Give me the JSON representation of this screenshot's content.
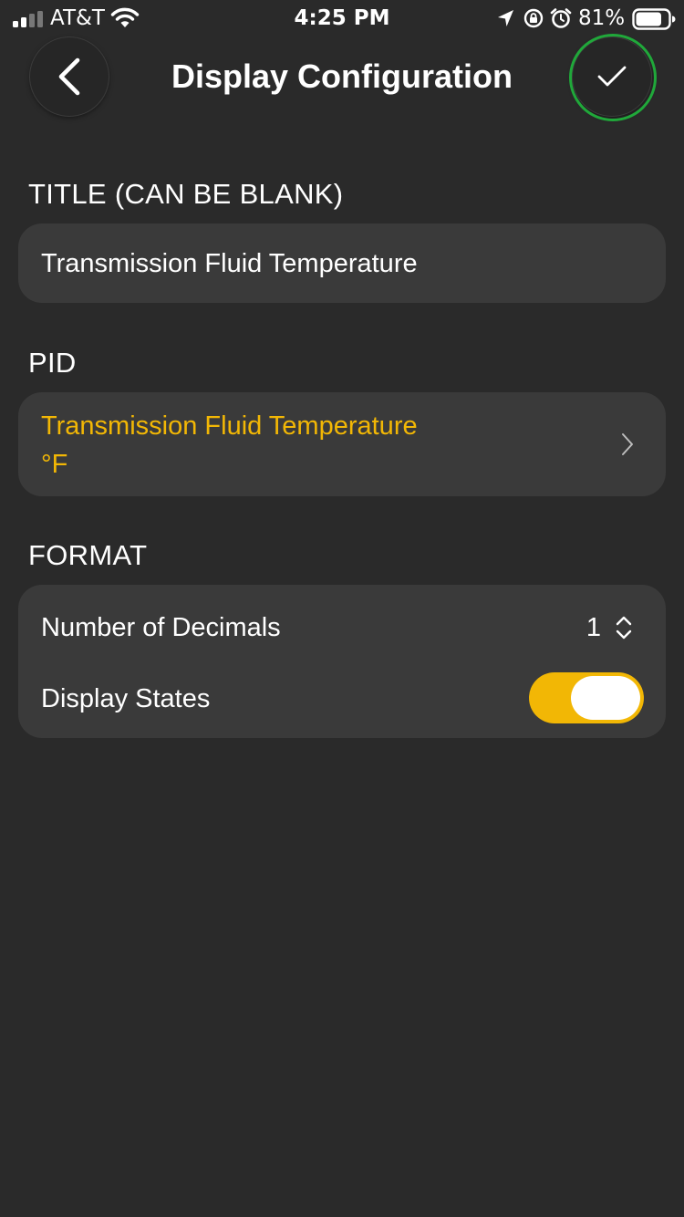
{
  "status_bar": {
    "carrier": "AT&T",
    "time": "4:25 PM",
    "battery_percent": "81%",
    "signal_icon": "signal-bars-icon",
    "wifi_icon": "wifi-icon",
    "location_icon": "location-arrow-icon",
    "rotation_lock_icon": "rotation-lock-icon",
    "alarm_icon": "alarm-icon",
    "battery_icon": "battery-icon",
    "battery_level": 0.81
  },
  "nav": {
    "title": "Display Configuration",
    "back_icon": "chevron-left-icon",
    "confirm_icon": "checkmark-icon"
  },
  "title_section": {
    "label": "TITLE (CAN BE BLANK)",
    "value": "Transmission Fluid Temperature"
  },
  "pid_section": {
    "label": "PID",
    "name": "Transmission Fluid Temperature",
    "unit": "°F",
    "chevron_icon": "chevron-right-icon"
  },
  "format_section": {
    "label": "FORMAT",
    "decimals_label": "Number of Decimals",
    "decimals_value": "1",
    "stepper_icon": "up-down-chevron-icon",
    "display_states_label": "Display States",
    "display_states_on": true
  },
  "colors": {
    "background": "#2a2a2a",
    "card": "#3a3a3a",
    "accent": "#f2b705",
    "highlight": "#20a83a",
    "text": "#ffffff"
  }
}
